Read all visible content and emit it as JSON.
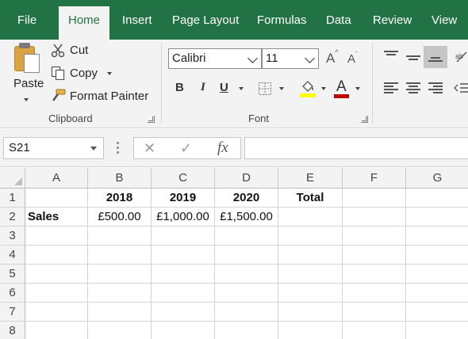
{
  "tabs": [
    "File",
    "Home",
    "Insert",
    "Page Layout",
    "Formulas",
    "Data",
    "Review",
    "View"
  ],
  "active_tab": "Home",
  "clipboard": {
    "paste_label": "Paste",
    "cut_label": "Cut",
    "copy_label": "Copy",
    "format_painter_label": "Format Painter",
    "group_label": "Clipboard"
  },
  "font": {
    "name": "Calibri",
    "size": "11",
    "grow_glyph": "A",
    "shrink_glyph": "A",
    "bold_glyph": "B",
    "italic_glyph": "I",
    "underline_glyph": "U",
    "font_color_glyph": "A",
    "group_label": "Font",
    "font_color": "#c00000",
    "fill_color": "#ffff00"
  },
  "formula_bar": {
    "name_box": "S21",
    "cancel_glyph": "✕",
    "enter_glyph": "✓",
    "fx_glyph": "fx",
    "formula": ""
  },
  "grid": {
    "columns": [
      "A",
      "B",
      "C",
      "D",
      "E",
      "F",
      "G"
    ],
    "rows": [
      {
        "num": "1",
        "cells": [
          "",
          "2018",
          "2019",
          "2020",
          "Total",
          "",
          ""
        ]
      },
      {
        "num": "2",
        "cells": [
          "Sales",
          "£500.00",
          "£1,000.00",
          "£1,500.00",
          "",
          "",
          ""
        ]
      },
      {
        "num": "3",
        "cells": [
          "",
          "",
          "",
          "",
          "",
          "",
          ""
        ]
      },
      {
        "num": "4",
        "cells": [
          "",
          "",
          "",
          "",
          "",
          "",
          ""
        ]
      },
      {
        "num": "5",
        "cells": [
          "",
          "",
          "",
          "",
          "",
          "",
          ""
        ]
      },
      {
        "num": "6",
        "cells": [
          "",
          "",
          "",
          "",
          "",
          "",
          ""
        ]
      },
      {
        "num": "7",
        "cells": [
          "",
          "",
          "",
          "",
          "",
          "",
          ""
        ]
      },
      {
        "num": "8",
        "cells": [
          "",
          "",
          "",
          "",
          "",
          "",
          ""
        ]
      }
    ]
  },
  "colors": {
    "accent": "#217346",
    "ribbon_bg": "#f3f3f3"
  }
}
